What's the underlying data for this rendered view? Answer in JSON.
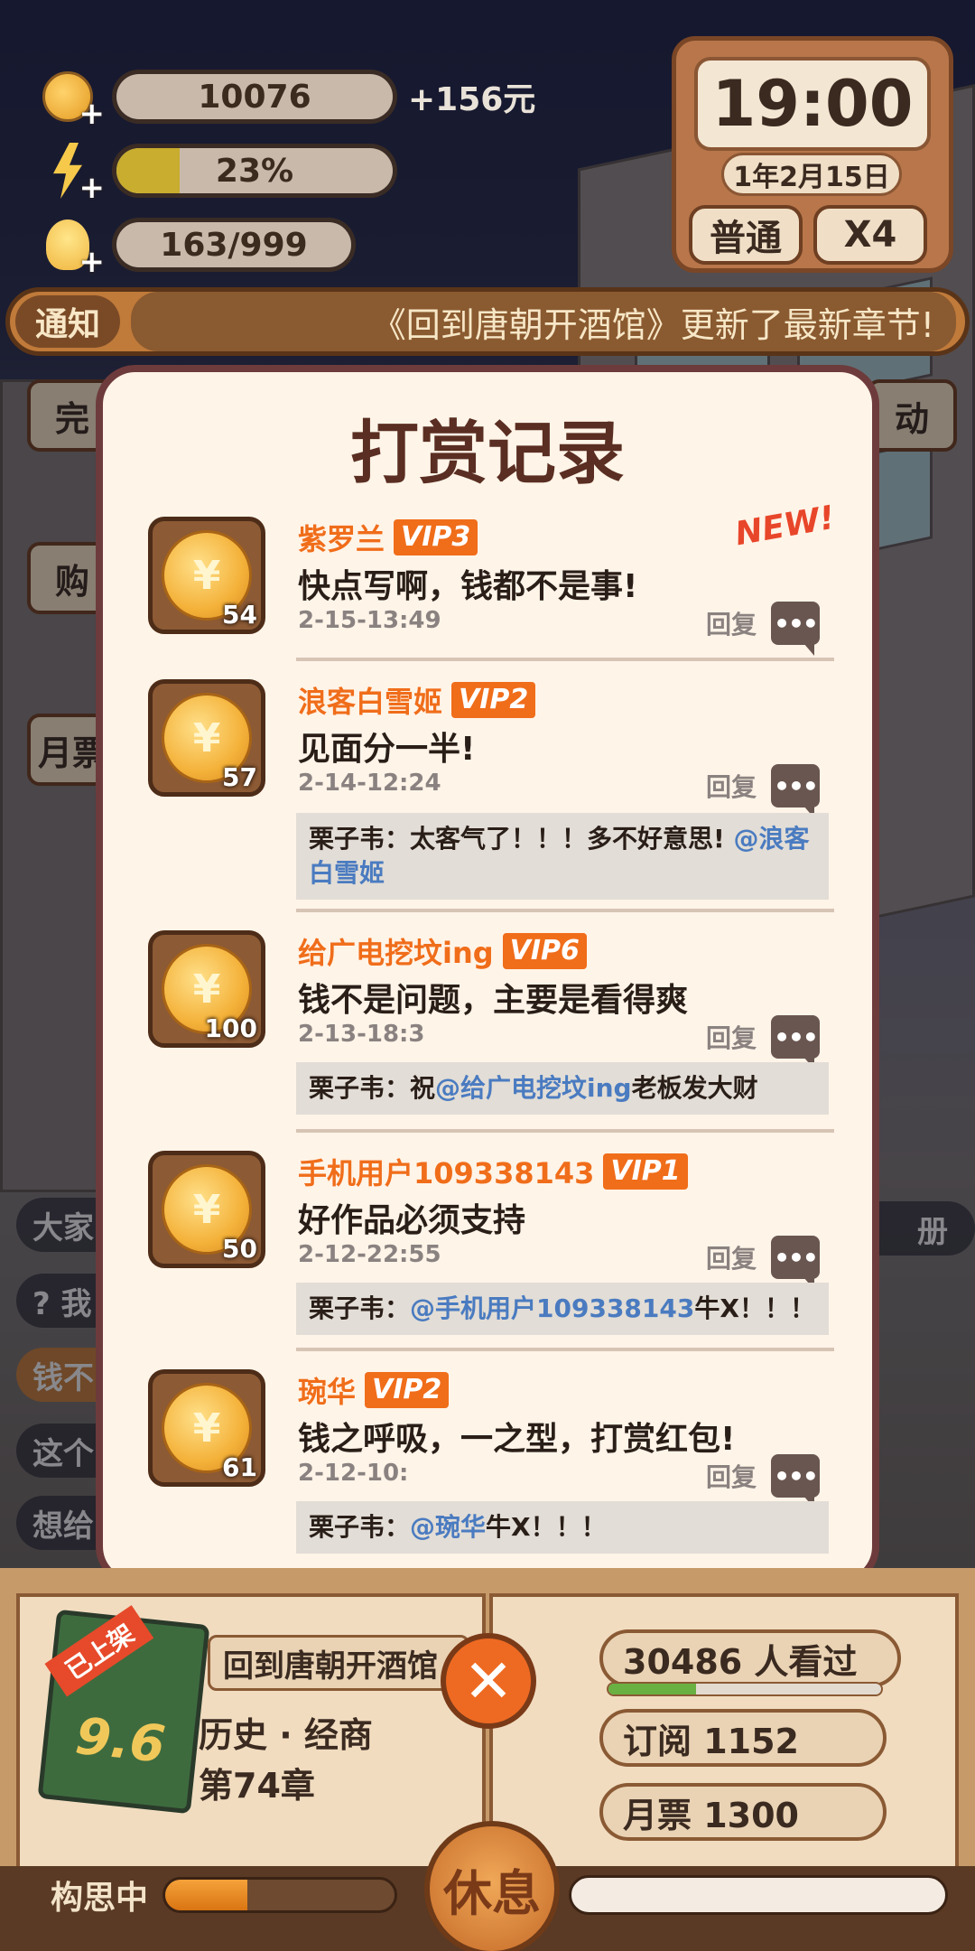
{
  "hud": {
    "coins": "10076",
    "coins_gain": "+156元",
    "energy_text": "23%",
    "energy_level": 0.23,
    "inspiration": "163/999"
  },
  "clock": {
    "time": "19:00",
    "date": "1年2月15日",
    "mode_label": "普通",
    "speed_label": "X4"
  },
  "notice": {
    "tag": "通知",
    "message": "《回到唐朝开酒馆》更新了最新章节!"
  },
  "background_peeks": {
    "left_btn_1": "完",
    "left_btn_2": "购",
    "left_btn_3": "月票",
    "right_btn_1": "动",
    "right_pill": "册",
    "chat": [
      "大家",
      "? 我",
      "钱不",
      "这个",
      "想给"
    ]
  },
  "modal": {
    "title": "打赏记录",
    "new_badge": "NEW!",
    "reply_label": "回复",
    "records": [
      {
        "amount": "54",
        "name": "紫罗兰",
        "vip": "VIP3",
        "message": "快点写啊，钱都不是事!",
        "time": "2-15-13:49",
        "reply": null
      },
      {
        "amount": "57",
        "name": "浪客白雪姬",
        "vip": "VIP2",
        "message": "见面分一半!",
        "time": "2-14-12:24",
        "reply": {
          "prefix": "栗子韦：太客气了！！！多不好意思! ",
          "mention": "@浪客白雪姬",
          "suffix": ""
        }
      },
      {
        "amount": "100",
        "name": "给广电挖坟ing",
        "vip": "VIP6",
        "message": "钱不是问题，主要是看得爽",
        "time": "2-13-18:3",
        "reply": {
          "prefix": "栗子韦：祝",
          "mention": "@给广电挖坟ing",
          "suffix": "老板发大财"
        }
      },
      {
        "amount": "50",
        "name": "手机用户109338143",
        "vip": "VIP1",
        "message": "好作品必须支持",
        "time": "2-12-22:55",
        "reply": {
          "prefix": "栗子韦：",
          "mention": "@手机用户109338143",
          "suffix": "牛X！！！"
        }
      },
      {
        "amount": "61",
        "name": "琬华",
        "vip": "VIP2",
        "message": "钱之呼吸，一之型，打赏红包!",
        "time": "2-12-10:",
        "reply": {
          "prefix": "栗子韦：",
          "mention": "@琬华",
          "suffix": "牛X！！！"
        }
      }
    ]
  },
  "book": {
    "status_ribbon": "已上架",
    "score": "9.6",
    "title": "回到唐朝开酒馆",
    "genre": "历史 · 经商",
    "chapter": "第74章",
    "readers": "30486   人看过",
    "readers_level": 0.32,
    "subscriptions": "订阅  1152",
    "monthly_tickets": "月票  1300",
    "think_label": "构思中",
    "think_level": 0.36,
    "rest_label": "休息"
  },
  "colors": {
    "accent_orange": "#f06d1a",
    "mention_blue": "#4a7bc0",
    "modal_border": "#6d3b3b"
  }
}
